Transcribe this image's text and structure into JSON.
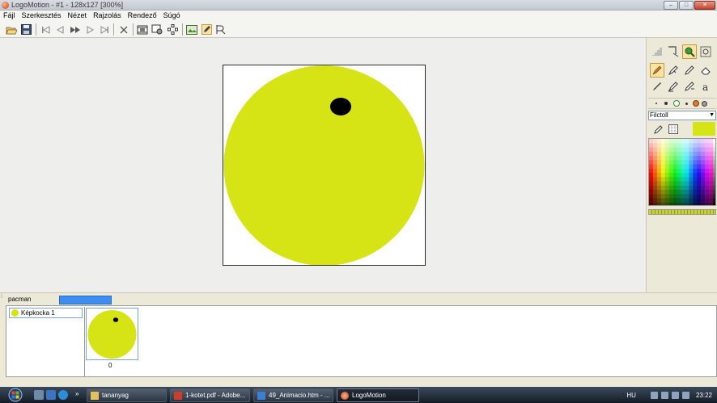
{
  "window": {
    "title": "LogoMotion - #1 - 128x127 [300%]",
    "controls": [
      "minimize-button",
      "maximize-button",
      "close-button"
    ]
  },
  "menu": [
    "Fájl",
    "Szerkesztés",
    "Nézet",
    "Rajzolás",
    "Rendező",
    "Súgó"
  ],
  "canvas": {
    "background": "#ffffff",
    "circle_color": "#d6e314",
    "eye_color": "#000000"
  },
  "right_panel": {
    "tool_select": "Filctoll",
    "current_color": "#d6e314"
  },
  "animation": {
    "tab_name": "pacman",
    "layer_name": "Képkocka 1",
    "frame_number": "0"
  },
  "taskbar": {
    "items": [
      {
        "label": "tananyag",
        "icon": "folder-icon"
      },
      {
        "label": "1-kotet.pdf - Adobe...",
        "icon": "pdf-icon"
      },
      {
        "label": "49_Animacio.htm - ...",
        "icon": "browser-icon"
      },
      {
        "label": "LogoMotion",
        "icon": "logomotion-icon"
      }
    ],
    "language": "HU",
    "clock": "23:22"
  },
  "colors": {
    "accent_blue": "#3d8ef0",
    "pacman_yellow": "#d6e314"
  }
}
